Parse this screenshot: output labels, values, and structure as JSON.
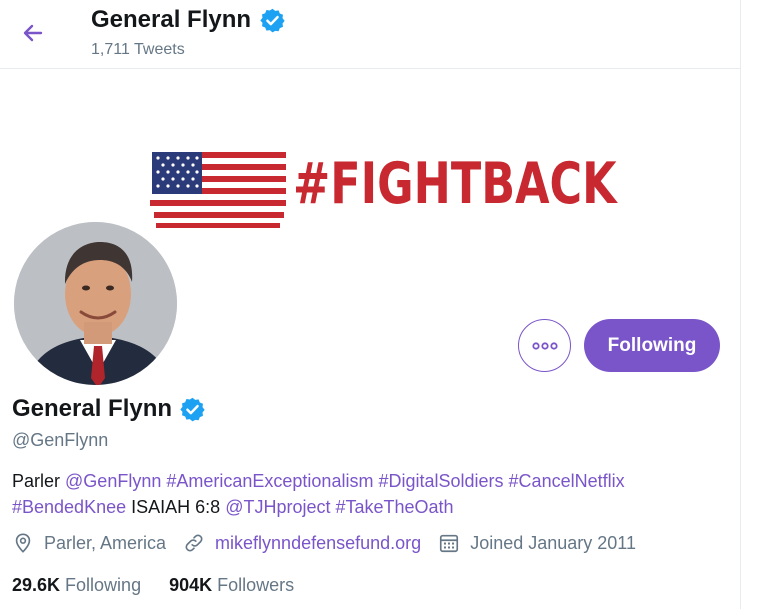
{
  "header": {
    "name": "General Flynn",
    "tweet_count": "1,711 Tweets"
  },
  "banner": {
    "text": "#FIGHTBACK"
  },
  "actions": {
    "following_label": "Following"
  },
  "profile": {
    "name": "General Flynn",
    "handle": "@GenFlynn",
    "bio": {
      "prefix": "Parler",
      "mention_1": "@GenFlynn",
      "hashtag_1": "#AmericanExceptionalism",
      "hashtag_2": "#DigitalSoldiers",
      "hashtag_3": "#CancelNetflix",
      "hashtag_4": "#BendedKnee",
      "plain": "ISAIAH 6:8",
      "mention_2": "@TJHproject",
      "hashtag_5": "#TakeTheOath"
    },
    "location": "Parler, America",
    "website": "mikeflynndefensefund.org",
    "joined": "Joined January 2011",
    "following_count": "29.6K",
    "following_label": "Following",
    "followers_count": "904K",
    "followers_label": "Followers"
  },
  "colors": {
    "accent": "#7a55c9",
    "verified": "#1da1f2",
    "secondary_text": "#657786",
    "banner_red": "#c8282f"
  },
  "icons": [
    "back-arrow-icon",
    "verified-badge-icon",
    "more-options-icon",
    "location-pin-icon",
    "link-icon",
    "calendar-icon"
  ]
}
